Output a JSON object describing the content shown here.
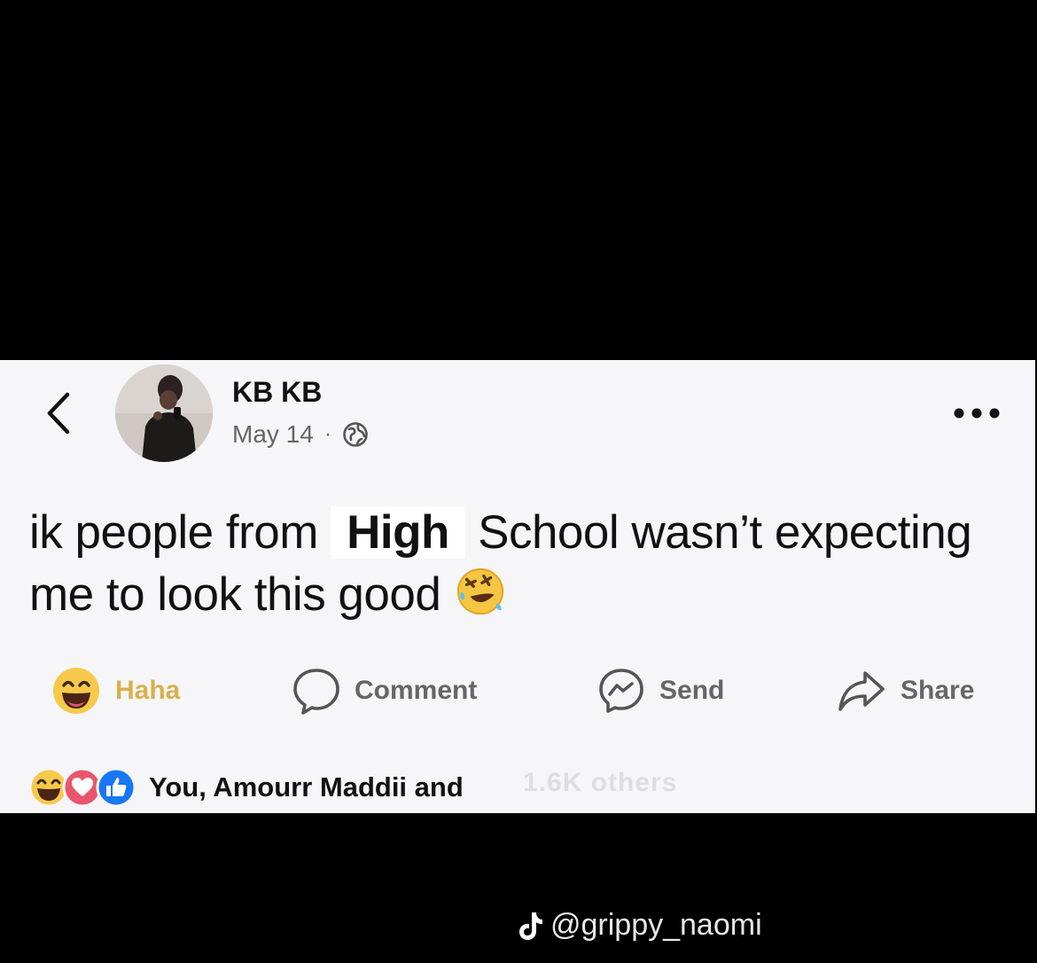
{
  "post": {
    "author_name": "KB KB",
    "date": "May 14",
    "meta_separator": "·",
    "audience_icon": "globe-icon",
    "text_before": "ik people from",
    "text_highlight": "High",
    "text_after": "School wasn’t expecting me to look this good",
    "emoji": "rolling-on-floor-laughing-emoji"
  },
  "actions": {
    "haha_label": "Haha",
    "comment_label": "Comment",
    "send_label": "Send",
    "share_label": "Share"
  },
  "reactions": {
    "icons": [
      "haha-icon",
      "love-icon",
      "like-icon"
    ],
    "summary": "You, Amourr Maddii and",
    "overlay": "1.6K others"
  },
  "watermark": {
    "platform_icon": "tiktok-icon",
    "handle": "@grippy_naomi"
  },
  "colors": {
    "card_bg": "#f6f6f8",
    "haha_yellow": "#d9b04a",
    "like_blue": "#1877f2",
    "love_pink": "#e8566c"
  }
}
